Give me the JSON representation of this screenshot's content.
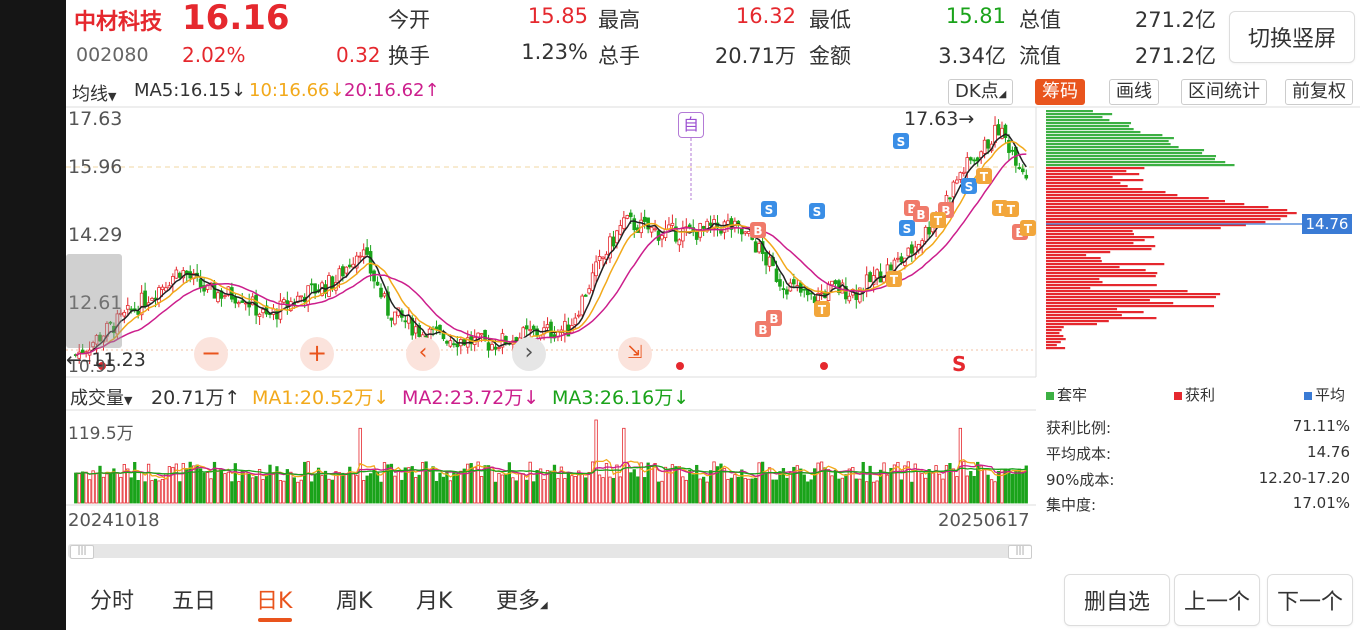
{
  "stock": {
    "name": "中材科技",
    "price": "16.16",
    "code": "002080",
    "change_pct": "2.02%",
    "change": "0.32"
  },
  "quote": [
    {
      "label": "今开",
      "value": "15.85",
      "color": "#e5282e"
    },
    {
      "label": "最高",
      "value": "16.32",
      "color": "#e5282e"
    },
    {
      "label": "最低",
      "value": "15.81",
      "color": "#1aa31a"
    },
    {
      "label": "总值",
      "value": "271.2亿",
      "color": "#333333"
    },
    {
      "label": "换手",
      "value": "1.23%",
      "color": "#333333"
    },
    {
      "label": "总手",
      "value": "20.71万",
      "color": "#333333"
    },
    {
      "label": "金额",
      "value": "3.34亿",
      "color": "#333333"
    },
    {
      "label": "流值",
      "value": "271.2亿",
      "color": "#333333"
    }
  ],
  "switch_label": "切换竖屏",
  "toolbar": {
    "ma_selector": "均线",
    "ma5": "MA5:16.15",
    "ma10": "10:16.66",
    "ma20": "20:16.62",
    "dk_label": "DK点",
    "buttons": [
      {
        "label": "筹码",
        "active": true
      },
      {
        "label": "画线",
        "active": false
      },
      {
        "label": "区间统计",
        "active": false
      },
      {
        "label": "前复权",
        "active": false
      }
    ]
  },
  "kline": {
    "y_labels": [
      "17.63",
      "15.96",
      "14.29",
      "12.61",
      "10.95"
    ],
    "high_annotation": "17.63",
    "low_annotation": "11.23",
    "zi_label": "自",
    "s_letter": "S",
    "t_letter": "T",
    "b_letter": "B",
    "s_label_red": "S"
  },
  "chips": {
    "price_tag": "14.76",
    "legend": [
      {
        "label": "套牢",
        "color": "#3cb043"
      },
      {
        "label": "获利",
        "color": "#e5282e"
      },
      {
        "label": "平均",
        "color": "#3a7bd5"
      }
    ],
    "stats": [
      {
        "label": "获利比例:",
        "value": "71.11%"
      },
      {
        "label": "平均成本:",
        "value": "14.76"
      },
      {
        "label": "90%成本:",
        "value": "12.20-17.20"
      },
      {
        "label": "集中度:",
        "value": "17.01%"
      }
    ]
  },
  "volume": {
    "selector": "成交量",
    "value": "20.71万",
    "ma1": "MA1:20.52万",
    "ma2": "MA2:23.72万",
    "ma3": "MA3:26.16万",
    "max_label": "119.5万",
    "date_start": "20241018",
    "date_end": "20250617"
  },
  "tabs": [
    {
      "label": "分时",
      "active": false
    },
    {
      "label": "五日",
      "active": false
    },
    {
      "label": "日K",
      "active": true
    },
    {
      "label": "周K",
      "active": false
    },
    {
      "label": "月K",
      "active": false
    },
    {
      "label": "更多",
      "active": false
    }
  ],
  "actions": {
    "remove_fav": "删自选",
    "prev": "上一个",
    "next": "下一个"
  }
}
